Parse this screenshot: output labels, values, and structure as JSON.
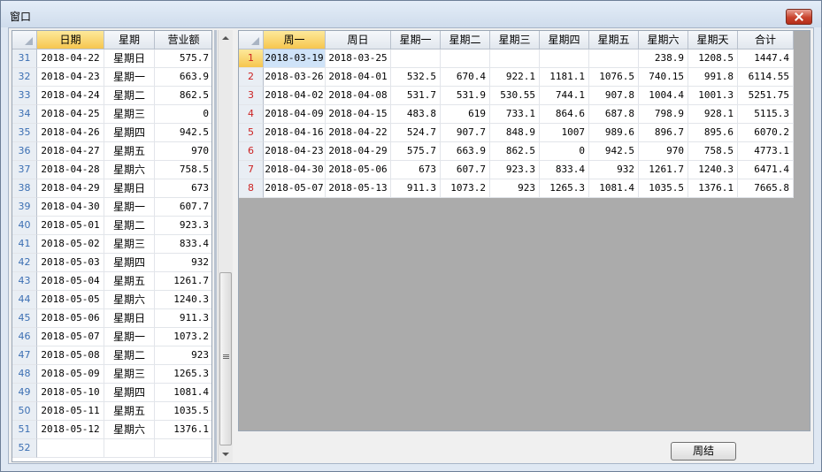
{
  "window": {
    "title": "窗口"
  },
  "left_grid": {
    "headers": [
      "日期",
      "星期",
      "营业额"
    ],
    "rows": [
      {
        "n": "31",
        "date": "2018-04-22",
        "weekday": "星期日",
        "value": "575.7"
      },
      {
        "n": "32",
        "date": "2018-04-23",
        "weekday": "星期一",
        "value": "663.9"
      },
      {
        "n": "33",
        "date": "2018-04-24",
        "weekday": "星期二",
        "value": "862.5"
      },
      {
        "n": "34",
        "date": "2018-04-25",
        "weekday": "星期三",
        "value": "0"
      },
      {
        "n": "35",
        "date": "2018-04-26",
        "weekday": "星期四",
        "value": "942.5"
      },
      {
        "n": "36",
        "date": "2018-04-27",
        "weekday": "星期五",
        "value": "970"
      },
      {
        "n": "37",
        "date": "2018-04-28",
        "weekday": "星期六",
        "value": "758.5"
      },
      {
        "n": "38",
        "date": "2018-04-29",
        "weekday": "星期日",
        "value": "673"
      },
      {
        "n": "39",
        "date": "2018-04-30",
        "weekday": "星期一",
        "value": "607.7"
      },
      {
        "n": "40",
        "date": "2018-05-01",
        "weekday": "星期二",
        "value": "923.3"
      },
      {
        "n": "41",
        "date": "2018-05-02",
        "weekday": "星期三",
        "value": "833.4"
      },
      {
        "n": "42",
        "date": "2018-05-03",
        "weekday": "星期四",
        "value": "932"
      },
      {
        "n": "43",
        "date": "2018-05-04",
        "weekday": "星期五",
        "value": "1261.7"
      },
      {
        "n": "44",
        "date": "2018-05-05",
        "weekday": "星期六",
        "value": "1240.3"
      },
      {
        "n": "45",
        "date": "2018-05-06",
        "weekday": "星期日",
        "value": "911.3"
      },
      {
        "n": "46",
        "date": "2018-05-07",
        "weekday": "星期一",
        "value": "1073.2"
      },
      {
        "n": "47",
        "date": "2018-05-08",
        "weekday": "星期二",
        "value": "923"
      },
      {
        "n": "48",
        "date": "2018-05-09",
        "weekday": "星期三",
        "value": "1265.3"
      },
      {
        "n": "49",
        "date": "2018-05-10",
        "weekday": "星期四",
        "value": "1081.4"
      },
      {
        "n": "50",
        "date": "2018-05-11",
        "weekday": "星期五",
        "value": "1035.5"
      },
      {
        "n": "51",
        "date": "2018-05-12",
        "weekday": "星期六",
        "value": "1376.1"
      },
      {
        "n": "52",
        "date": "",
        "weekday": "",
        "value": ""
      }
    ]
  },
  "right_grid": {
    "headers": [
      "周一",
      "周日",
      "星期一",
      "星期二",
      "星期三",
      "星期四",
      "星期五",
      "星期六",
      "星期天",
      "合计"
    ],
    "rows": [
      {
        "n": "1",
        "cells": [
          "2018-03-19",
          "2018-03-25",
          "",
          "",
          "",
          "",
          "",
          "238.9",
          "1208.5",
          "1447.4"
        ]
      },
      {
        "n": "2",
        "cells": [
          "2018-03-26",
          "2018-04-01",
          "532.5",
          "670.4",
          "922.1",
          "1181.1",
          "1076.5",
          "740.15",
          "991.8",
          "6114.55"
        ]
      },
      {
        "n": "3",
        "cells": [
          "2018-04-02",
          "2018-04-08",
          "531.7",
          "531.9",
          "530.55",
          "744.1",
          "907.8",
          "1004.4",
          "1001.3",
          "5251.75"
        ]
      },
      {
        "n": "4",
        "cells": [
          "2018-04-09",
          "2018-04-15",
          "483.8",
          "619",
          "733.1",
          "864.6",
          "687.8",
          "798.9",
          "928.1",
          "5115.3"
        ]
      },
      {
        "n": "5",
        "cells": [
          "2018-04-16",
          "2018-04-22",
          "524.7",
          "907.7",
          "848.9",
          "1007",
          "989.6",
          "896.7",
          "895.6",
          "6070.2"
        ]
      },
      {
        "n": "6",
        "cells": [
          "2018-04-23",
          "2018-04-29",
          "575.7",
          "663.9",
          "862.5",
          "0",
          "942.5",
          "970",
          "758.5",
          "4773.1"
        ]
      },
      {
        "n": "7",
        "cells": [
          "2018-04-30",
          "2018-05-06",
          "673",
          "607.7",
          "923.3",
          "833.4",
          "932",
          "1261.7",
          "1240.3",
          "6471.4"
        ]
      },
      {
        "n": "8",
        "cells": [
          "2018-05-07",
          "2018-05-13",
          "911.3",
          "1073.2",
          "923",
          "1265.3",
          "1081.4",
          "1035.5",
          "1376.1",
          "7665.8"
        ]
      }
    ]
  },
  "buttons": {
    "summary": "周结"
  },
  "icons": {
    "close": "close-icon",
    "corner": "select-all-icon",
    "scroll_up": "scroll-up-icon",
    "scroll_down": "scroll-down-icon"
  },
  "colors": {
    "header_selected": "#f6c64f",
    "row_number_left": "#3b6fb3",
    "row_number_right": "#cc2222",
    "close_button": "#c9432d"
  }
}
